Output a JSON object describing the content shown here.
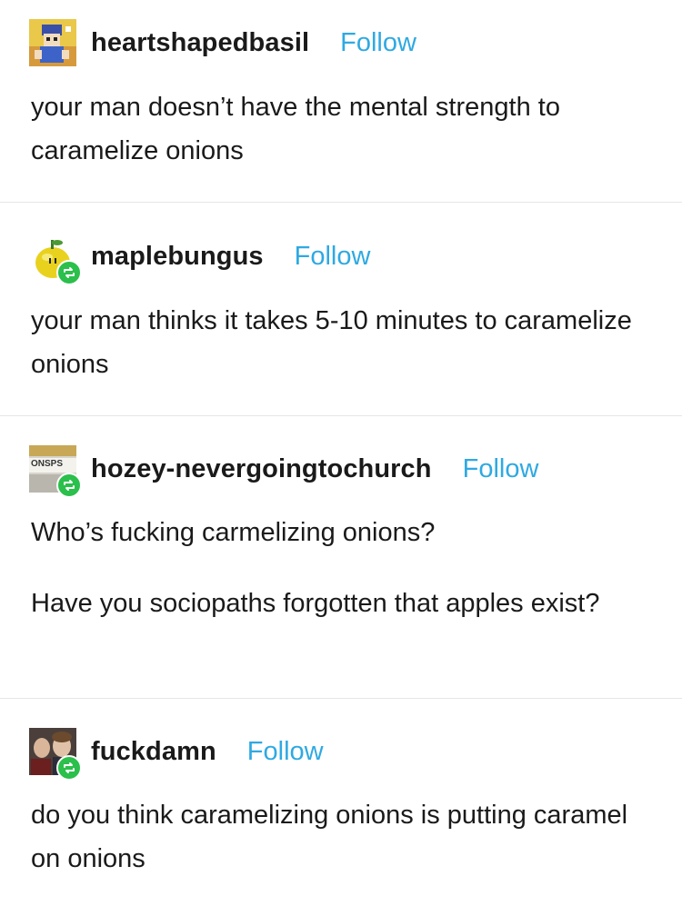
{
  "posts": [
    {
      "username": "heartshapedbasil",
      "follow_label": "Follow",
      "avatar_icon": "pixel-art-avatar-icon",
      "paragraphs": [
        "your man doesn’t have the mental strength to caramelize onions"
      ]
    },
    {
      "username": "maplebungus",
      "follow_label": "Follow",
      "avatar_icon": "lemon-avatar-icon",
      "reblog_icon": "reblog-icon",
      "paragraphs": [
        "your man thinks it takes 5-10 minutes to caramelize onions"
      ]
    },
    {
      "username": "hozey-nevergoingtochurch",
      "follow_label": "Follow",
      "avatar_icon": "sign-photo-avatar-icon",
      "avatar_text": "ONSPS",
      "reblog_icon": "reblog-icon",
      "paragraphs": [
        "Who’s fucking carmelizing onions?",
        "Have you sociopaths forgotten that apples exist?"
      ]
    },
    {
      "username": "fuckdamn",
      "follow_label": "Follow",
      "avatar_icon": "photo-avatar-icon",
      "reblog_icon": "reblog-icon",
      "paragraphs": [
        "do you think caramelizing onions is putting caramel on onions"
      ]
    }
  ],
  "colors": {
    "follow": "#2fa9e2",
    "reblog_badge": "#2bbf4b",
    "text": "#1a1a1a",
    "divider": "#e6e6e6"
  }
}
